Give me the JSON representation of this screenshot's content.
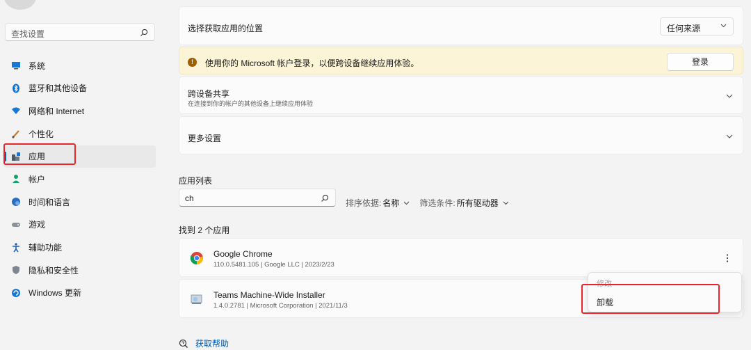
{
  "sidebar": {
    "search_placeholder": "查找设置",
    "items": [
      {
        "label": "系统",
        "icon": "system-icon"
      },
      {
        "label": "蓝牙和其他设备",
        "icon": "bluetooth-icon"
      },
      {
        "label": "网络和 Internet",
        "icon": "wifi-icon"
      },
      {
        "label": "个性化",
        "icon": "brush-icon"
      },
      {
        "label": "应用",
        "icon": "apps-icon",
        "active": true
      },
      {
        "label": "帐户",
        "icon": "person-icon"
      },
      {
        "label": "时间和语言",
        "icon": "globe-clock-icon"
      },
      {
        "label": "游戏",
        "icon": "gamepad-icon"
      },
      {
        "label": "辅助功能",
        "icon": "accessibility-icon"
      },
      {
        "label": "隐私和安全性",
        "icon": "shield-icon"
      },
      {
        "label": "Windows 更新",
        "icon": "update-icon"
      }
    ]
  },
  "main": {
    "install_source": {
      "label": "选择获取应用的位置",
      "value": "任何来源"
    },
    "banner": {
      "text": "使用你的 Microsoft 帐户登录，以便跨设备继续应用体验。",
      "button": "登录"
    },
    "share": {
      "title": "跨设备共享",
      "subtitle": "在连接到你的帐户的其他设备上继续应用体验"
    },
    "more_settings": {
      "title": "更多设置"
    },
    "app_list": {
      "title": "应用列表",
      "search_value": "ch",
      "sort_label": "排序依据:",
      "sort_value": "名称",
      "filter_label": "筛选条件:",
      "filter_value": "所有驱动器",
      "found": "找到 2 个应用",
      "apps": [
        {
          "name": "Google Chrome",
          "meta": "110.0.5481.105  |  Google LLC  |  2023/2/23",
          "icon": "chrome-icon"
        },
        {
          "name": "Teams Machine-Wide Installer",
          "meta": "1.4.0.2781  |  Microsoft Corporation  |  2021/11/3",
          "icon": "installer-icon"
        }
      ]
    },
    "context_menu": {
      "modify": "修改",
      "uninstall": "卸载"
    },
    "help": "获取帮助"
  },
  "colors": {
    "accent": "#005fb8",
    "highlight": "#e8262a",
    "banner_bg": "#fcf4d6"
  }
}
